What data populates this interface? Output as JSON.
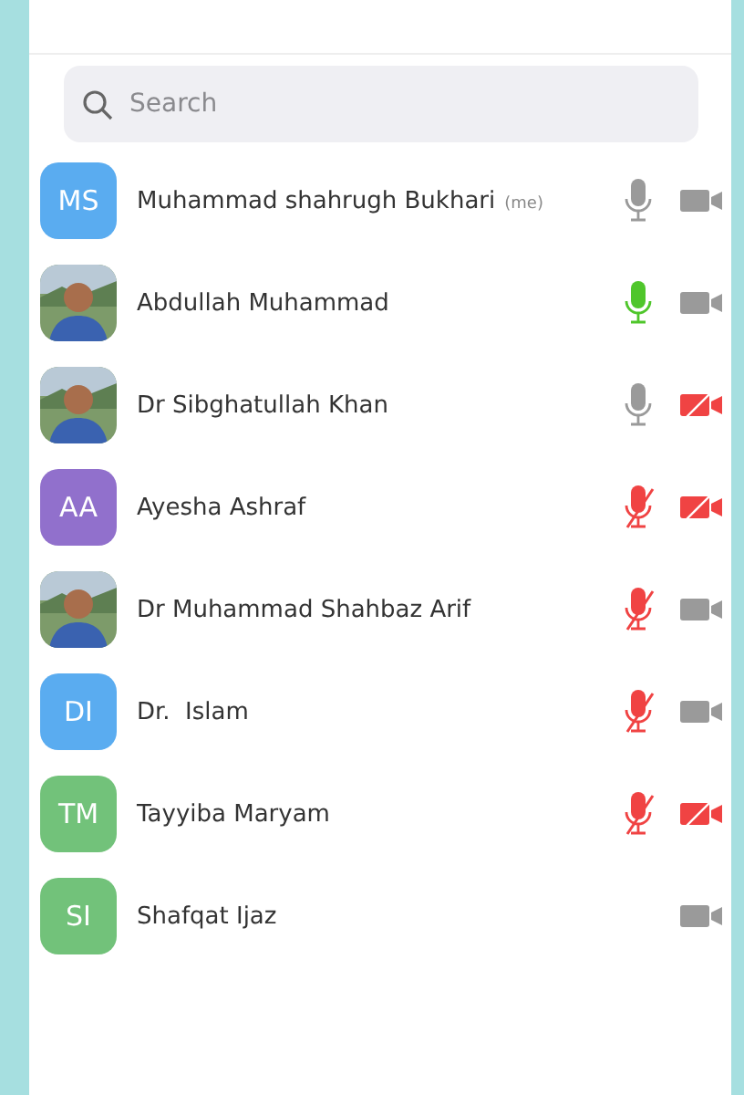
{
  "search": {
    "placeholder": "Search"
  },
  "participants": [
    {
      "name": "Muhammad shahrugh Bukhari",
      "tag": "(me)",
      "avatar": {
        "kind": "initials",
        "text": "MS",
        "color": "#5aacf0"
      },
      "mic": {
        "muted": false,
        "speaking": false
      },
      "video_off": false
    },
    {
      "name": "Abdullah Muhammad",
      "mic": {
        "muted": false,
        "speaking": true
      },
      "video_off": false
    },
    {
      "name": "Dr Sibghatullah Khan",
      "mic": {
        "muted": false,
        "speaking": false
      },
      "video_off": true
    },
    {
      "name": "Ayesha Ashraf",
      "avatar": {
        "kind": "initials",
        "text": "AA",
        "color": "#9170cc"
      },
      "mic": {
        "muted": true,
        "speaking": false
      },
      "video_off": true
    },
    {
      "name": "Dr Muhammad Shahbaz Arif",
      "mic": {
        "muted": true,
        "speaking": false
      },
      "video_off": false
    },
    {
      "name": "Dr.  Islam",
      "avatar": {
        "kind": "initials",
        "text": "DI",
        "color": "#5aacf0"
      },
      "mic": {
        "muted": true,
        "speaking": false
      },
      "video_off": false
    },
    {
      "name": "Tayyiba Maryam",
      "avatar": {
        "kind": "initials",
        "text": "TM",
        "color": "#72c27a"
      },
      "mic": {
        "muted": true,
        "speaking": false
      },
      "video_off": true
    },
    {
      "name": "Shafqat Ijaz",
      "avatar": {
        "kind": "initials",
        "text": "SI",
        "color": "#72c27a"
      },
      "video_off": false
    }
  ]
}
